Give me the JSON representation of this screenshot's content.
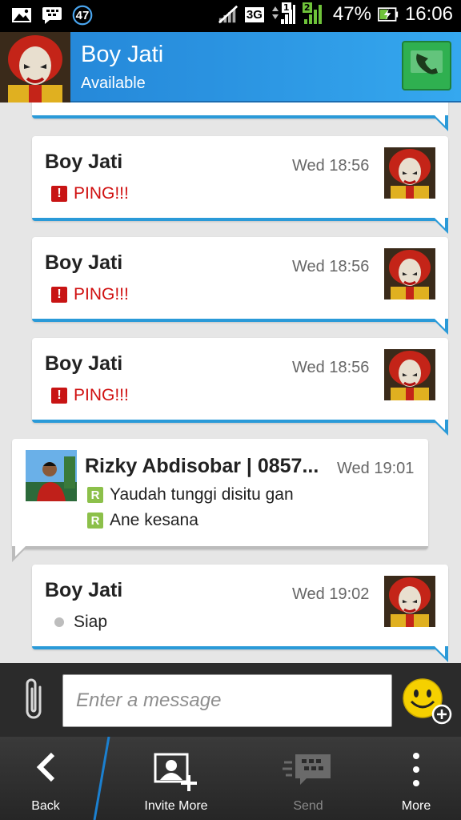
{
  "status_bar": {
    "notification_count": "47",
    "network": "3G",
    "sim_label": "1",
    "sim2_label": "2",
    "battery": "47%",
    "time": "16:06",
    "icons": [
      "image-icon",
      "bbm-icon",
      "notification-count-icon",
      "signal-muted-icon",
      "3g-icon",
      "signal-icon",
      "battery-charging-icon"
    ]
  },
  "header": {
    "contact_name": "Boy Jati",
    "contact_status": "Available",
    "call_icon": "phone-icon"
  },
  "messages": [
    {
      "sender": "Boy Jati",
      "time": "Wed 18:56",
      "direction": "out",
      "lines": [
        {
          "type": "ping",
          "icon": "!",
          "text": "PING!!!"
        }
      ]
    },
    {
      "sender": "Boy Jati",
      "time": "Wed 18:56",
      "direction": "out",
      "lines": [
        {
          "type": "ping",
          "icon": "!",
          "text": "PING!!!"
        }
      ]
    },
    {
      "sender": "Boy Jati",
      "time": "Wed 18:56",
      "direction": "out",
      "lines": [
        {
          "type": "ping",
          "icon": "!",
          "text": "PING!!!"
        }
      ]
    },
    {
      "sender": "Rizky Abdisobar | 0857...",
      "time": "Wed 19:01",
      "direction": "in",
      "lines": [
        {
          "type": "read",
          "icon": "R",
          "text": "Yaudah tunggi disitu gan"
        },
        {
          "type": "read",
          "icon": "R",
          "text": "Ane kesana"
        }
      ]
    },
    {
      "sender": "Boy Jati",
      "time": "Wed 19:02",
      "direction": "out",
      "lines": [
        {
          "type": "sent",
          "icon": "",
          "text": "Siap"
        }
      ]
    }
  ],
  "composer": {
    "placeholder": "Enter a message",
    "attach_icon": "paperclip-icon",
    "emoji_icon": "smiley-add-icon"
  },
  "toolbar": {
    "back_label": "Back",
    "invite_label": "Invite More",
    "send_label": "Send",
    "more_label": "More"
  },
  "colors": {
    "header_blue": "#2a92e0",
    "bubble_accent": "#2a9ad8",
    "ping_red": "#d01010",
    "read_green": "#8cc04a",
    "call_green": "#2fb050"
  }
}
